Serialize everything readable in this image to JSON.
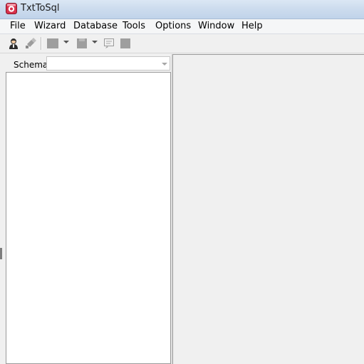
{
  "window": {
    "title": "TxtToSql",
    "icon": "app-logo-icon"
  },
  "menu": {
    "items": [
      {
        "label": "File"
      },
      {
        "label": "Wizard"
      },
      {
        "label": "Database"
      },
      {
        "label": "Tools"
      },
      {
        "label": "Options"
      },
      {
        "label": "Window"
      },
      {
        "label": "Help"
      }
    ]
  },
  "toolbar": {
    "buttons": [
      {
        "icon": "connect-user-icon",
        "enabled": true
      },
      {
        "icon": "disconnect-icon",
        "enabled": false
      },
      {
        "icon": "open-icon",
        "enabled": false,
        "dropdown": true
      },
      {
        "icon": "save-icon",
        "enabled": false,
        "dropdown": true
      },
      {
        "icon": "run-icon",
        "enabled": false
      },
      {
        "icon": "stop-icon",
        "enabled": false
      }
    ]
  },
  "schema_panel": {
    "label": "Schema",
    "selected_value": ""
  },
  "colors": {
    "titlebar": "#cddcee",
    "background": "#f0f0f0",
    "panel_border": "#9a9a9a"
  }
}
